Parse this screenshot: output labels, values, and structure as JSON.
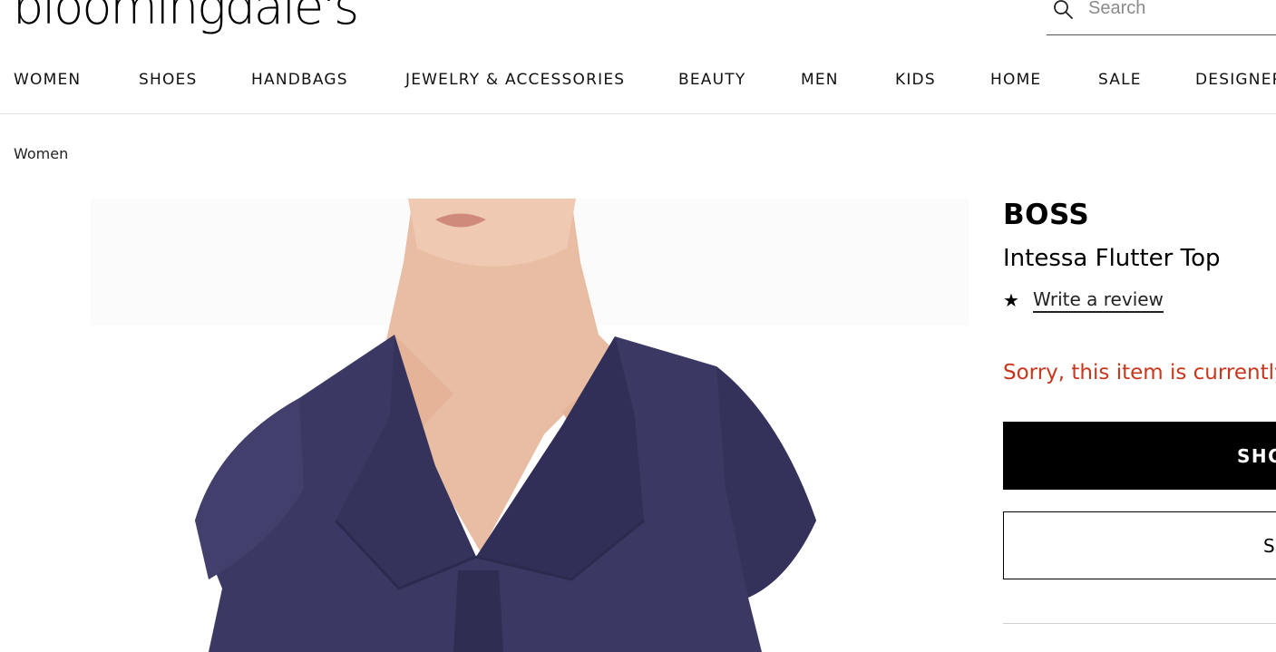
{
  "header": {
    "logo_text": "bloomingdale's",
    "search": {
      "placeholder": "Search",
      "value": ""
    }
  },
  "nav": {
    "items": [
      {
        "label": "WOMEN"
      },
      {
        "label": "SHOES"
      },
      {
        "label": "HANDBAGS"
      },
      {
        "label": "JEWELRY & ACCESSORIES"
      },
      {
        "label": "BEAUTY"
      },
      {
        "label": "MEN"
      },
      {
        "label": "KIDS"
      },
      {
        "label": "HOME"
      },
      {
        "label": "SALE"
      },
      {
        "label": "DESIGNERS"
      }
    ]
  },
  "breadcrumb": {
    "label": "Women"
  },
  "product": {
    "brand": "BOSS",
    "name": "Intessa Flutter Top",
    "rating_icon": "star-icon",
    "review_link": "Write a review",
    "status": "Sorry, this item is currently",
    "primary_button": "SHOP",
    "secondary_button": "S",
    "image": {
      "icon": "product-photo",
      "colors": {
        "garment": "#3b3963",
        "skin": "#e6b79b",
        "background": "#ffffff"
      }
    }
  },
  "colors": {
    "accent_error": "#c8361c",
    "primary_button_bg": "#000000",
    "divider": "#e2e2e2"
  }
}
